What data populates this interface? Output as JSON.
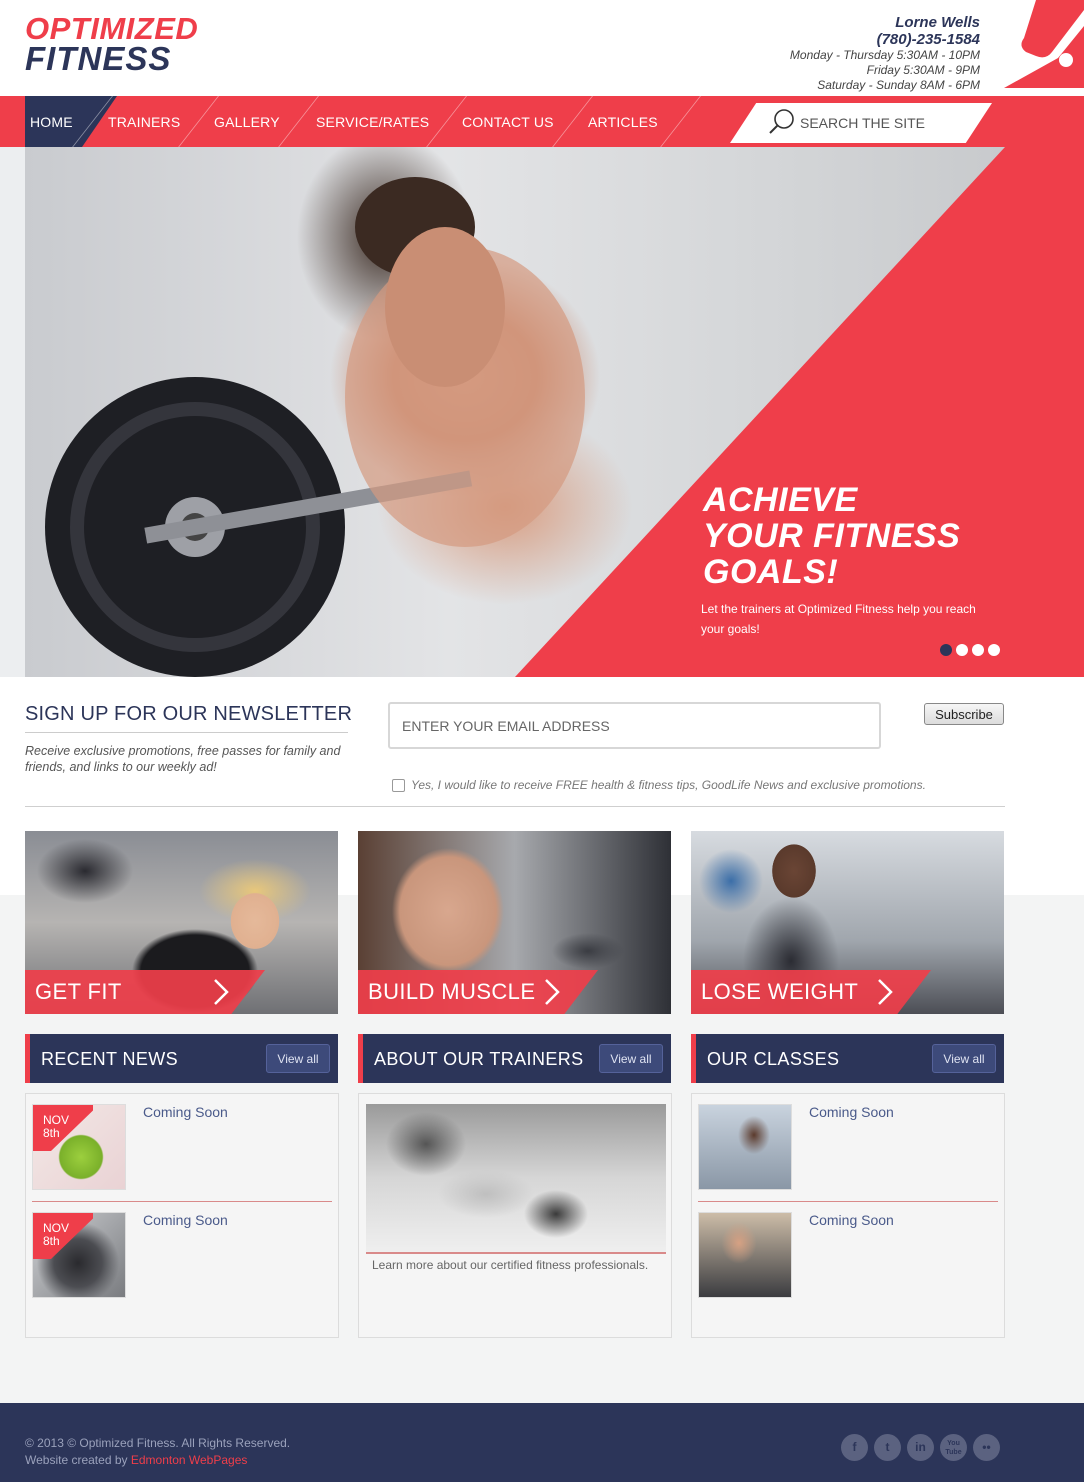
{
  "header": {
    "logo_line1": "OPTIMIZED",
    "logo_line2": "FITNESS",
    "contact_name": "Lorne Wells",
    "phone": "(780)-235-1584",
    "hours": [
      "Monday - Thursday 5:30AM - 10PM",
      "Friday 5:30AM - 9PM",
      "Saturday - Sunday 8AM - 6PM"
    ]
  },
  "nav": {
    "items": [
      "HOME",
      "TRAINERS",
      "GALLERY",
      "SERVICE/RATES",
      "CONTACT US",
      "ARTICLES"
    ],
    "active": "HOME",
    "search_placeholder": "SEARCH THE SITE"
  },
  "hero": {
    "title_lines": [
      "ACHIEVE",
      "YOUR FITNESS",
      "GOALS!"
    ],
    "text": "Let the trainers at Optimized Fitness help you reach your goals!",
    "slide_count": 4,
    "active_slide": 1
  },
  "newsletter": {
    "title": "SIGN UP FOR OUR NEWSLETTER",
    "description": "Receive exclusive promotions, free passes for family and friends, and links to our weekly ad!",
    "email_placeholder": "ENTER YOUR EMAIL ADDRESS",
    "subscribe_label": "Subscribe",
    "checkbox_label": "Yes, I would like to receive FREE health & fitness tips, GoodLife News and exclusive promotions.",
    "checkbox_checked": false
  },
  "features": [
    {
      "label": "GET FIT"
    },
    {
      "label": "BUILD MUSCLE"
    },
    {
      "label": "LOSE WEIGHT"
    }
  ],
  "sections": {
    "news": {
      "title": "RECENT NEWS",
      "view_all": "View all",
      "items": [
        {
          "month": "NOV",
          "day": "8th",
          "title": "Coming Soon"
        },
        {
          "month": "NOV",
          "day": "8th",
          "title": "Coming Soon"
        }
      ]
    },
    "trainers": {
      "title": "ABOUT OUR TRAINERS",
      "view_all": "View all",
      "caption": "Learn more about our certified fitness professionals."
    },
    "classes": {
      "title": "OUR CLASSES",
      "view_all": "View all",
      "items": [
        {
          "title": "Coming Soon"
        },
        {
          "title": "Coming Soon"
        }
      ]
    }
  },
  "footer": {
    "copyright": "© 2013 © Optimized Fitness. All Rights Reserved.",
    "credit_prefix": "Website created by",
    "credit_link": "Edmonton WebPages",
    "social": [
      "f",
      "t",
      "in",
      "You Tube",
      "••"
    ]
  },
  "colors": {
    "accent": "#ef3e4a",
    "navy": "#2c3559"
  }
}
